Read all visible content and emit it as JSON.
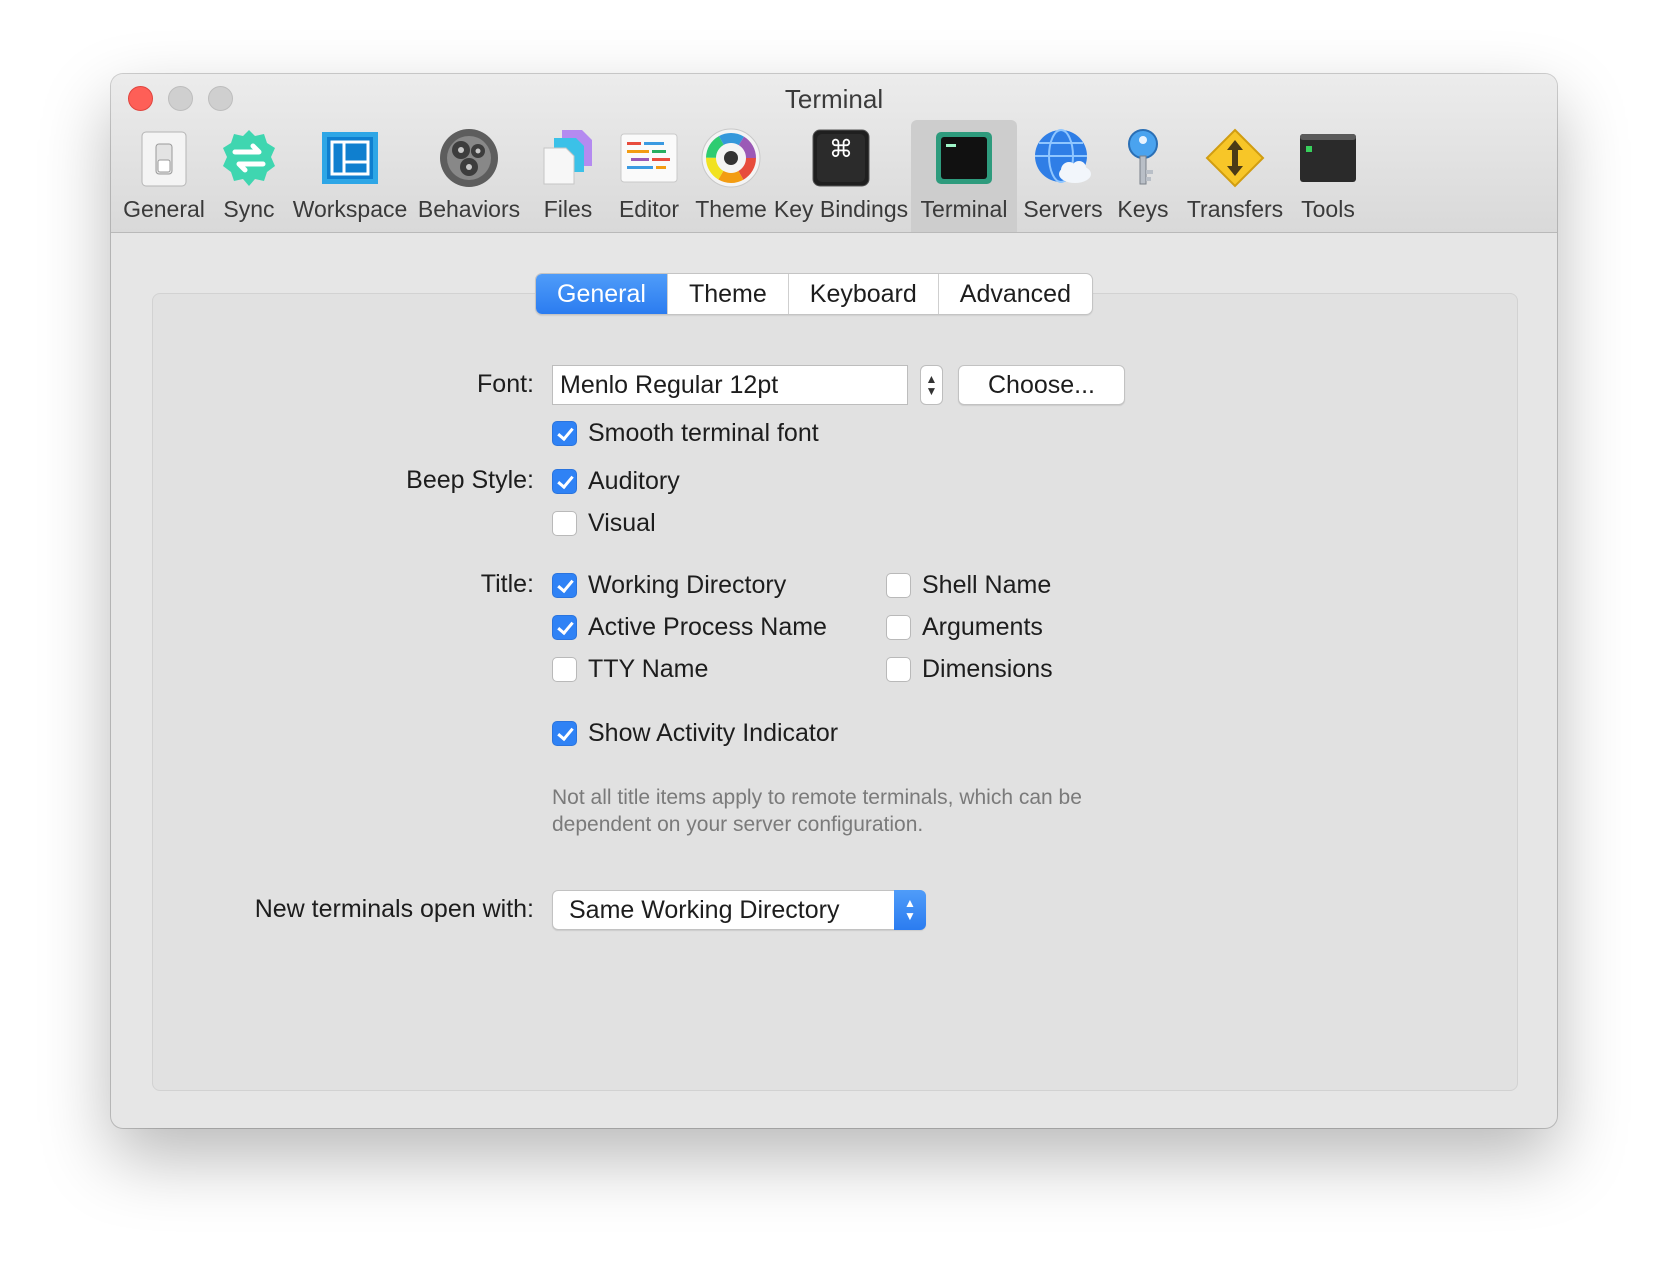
{
  "window": {
    "title": "Terminal"
  },
  "toolbar": {
    "items": [
      {
        "label": "General",
        "icon": "switch-icon"
      },
      {
        "label": "Sync",
        "icon": "sync-icon"
      },
      {
        "label": "Workspace",
        "icon": "workspace-icon"
      },
      {
        "label": "Behaviors",
        "icon": "gears-icon"
      },
      {
        "label": "Files",
        "icon": "files-icon"
      },
      {
        "label": "Editor",
        "icon": "editor-icon"
      },
      {
        "label": "Theme",
        "icon": "color-wheel-icon"
      },
      {
        "label": "Key Bindings",
        "icon": "command-key-icon"
      },
      {
        "label": "Terminal",
        "icon": "terminal-icon",
        "selected": true
      },
      {
        "label": "Servers",
        "icon": "globe-cloud-icon"
      },
      {
        "label": "Keys",
        "icon": "key-icon"
      },
      {
        "label": "Transfers",
        "icon": "transfer-arrows-icon"
      },
      {
        "label": "Tools",
        "icon": "tools-icon"
      }
    ]
  },
  "tabs": {
    "items": [
      "General",
      "Theme",
      "Keyboard",
      "Advanced"
    ],
    "active": "General"
  },
  "font": {
    "label": "Font:",
    "value": "Menlo Regular 12pt",
    "choose_label": "Choose...",
    "smooth_label": "Smooth terminal font",
    "smooth_checked": true
  },
  "beep": {
    "label": "Beep Style:",
    "auditory": "Auditory",
    "auditory_checked": true,
    "visual": "Visual",
    "visual_checked": false
  },
  "title_opts": {
    "label": "Title:",
    "working_directory": "Working Directory",
    "active_process_name": "Active Process Name",
    "tty_name": "TTY Name",
    "shell_name": "Shell Name",
    "arguments": "Arguments",
    "dimensions": "Dimensions"
  },
  "activity": {
    "label": "Show Activity Indicator",
    "checked": true
  },
  "note": "Not all title items apply to remote terminals, which can be dependent on your server configuration.",
  "new_terminals": {
    "label": "New terminals open with:",
    "value": "Same Working Directory"
  },
  "colors": {
    "accent": "#2f82f5",
    "close": "#fe5f57"
  }
}
